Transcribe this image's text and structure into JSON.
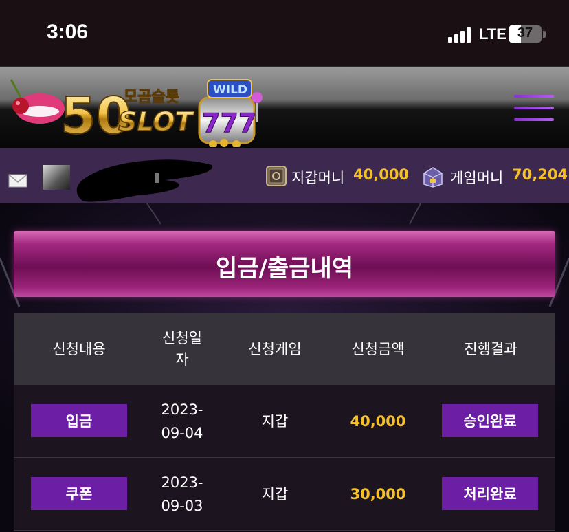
{
  "status_bar": {
    "time": "3:06",
    "network": "LTE",
    "battery": "37",
    "battery_level": 0.37
  },
  "header": {
    "logo_top_text": "모곰슬롯",
    "logo_number": "50",
    "logo_word": "SLOT",
    "logo_badge": "WILD",
    "logo_reels": "777"
  },
  "user_bar": {
    "wallet_label": "지갑머니",
    "wallet_value": "40,000",
    "game_label": "게임머니",
    "game_value": "70,204"
  },
  "page_title": "입금/출금내역",
  "table": {
    "headers": [
      "신청내용",
      "신청일\n자",
      "신청게임",
      "신청금액",
      "진행결과"
    ],
    "rows": [
      {
        "type": "입금",
        "date": "2023-\n09-04",
        "game": "지갑",
        "amount": "40,000",
        "status": "승인완료"
      },
      {
        "type": "쿠폰",
        "date": "2023-\n09-03",
        "game": "지갑",
        "amount": "30,000",
        "status": "처리완료"
      }
    ]
  },
  "colors": {
    "accent_gold": "#f4c12a",
    "tag_purple": "#6c1fa4",
    "userbar": "#3d2950",
    "banner_pink": "#a2287f"
  }
}
